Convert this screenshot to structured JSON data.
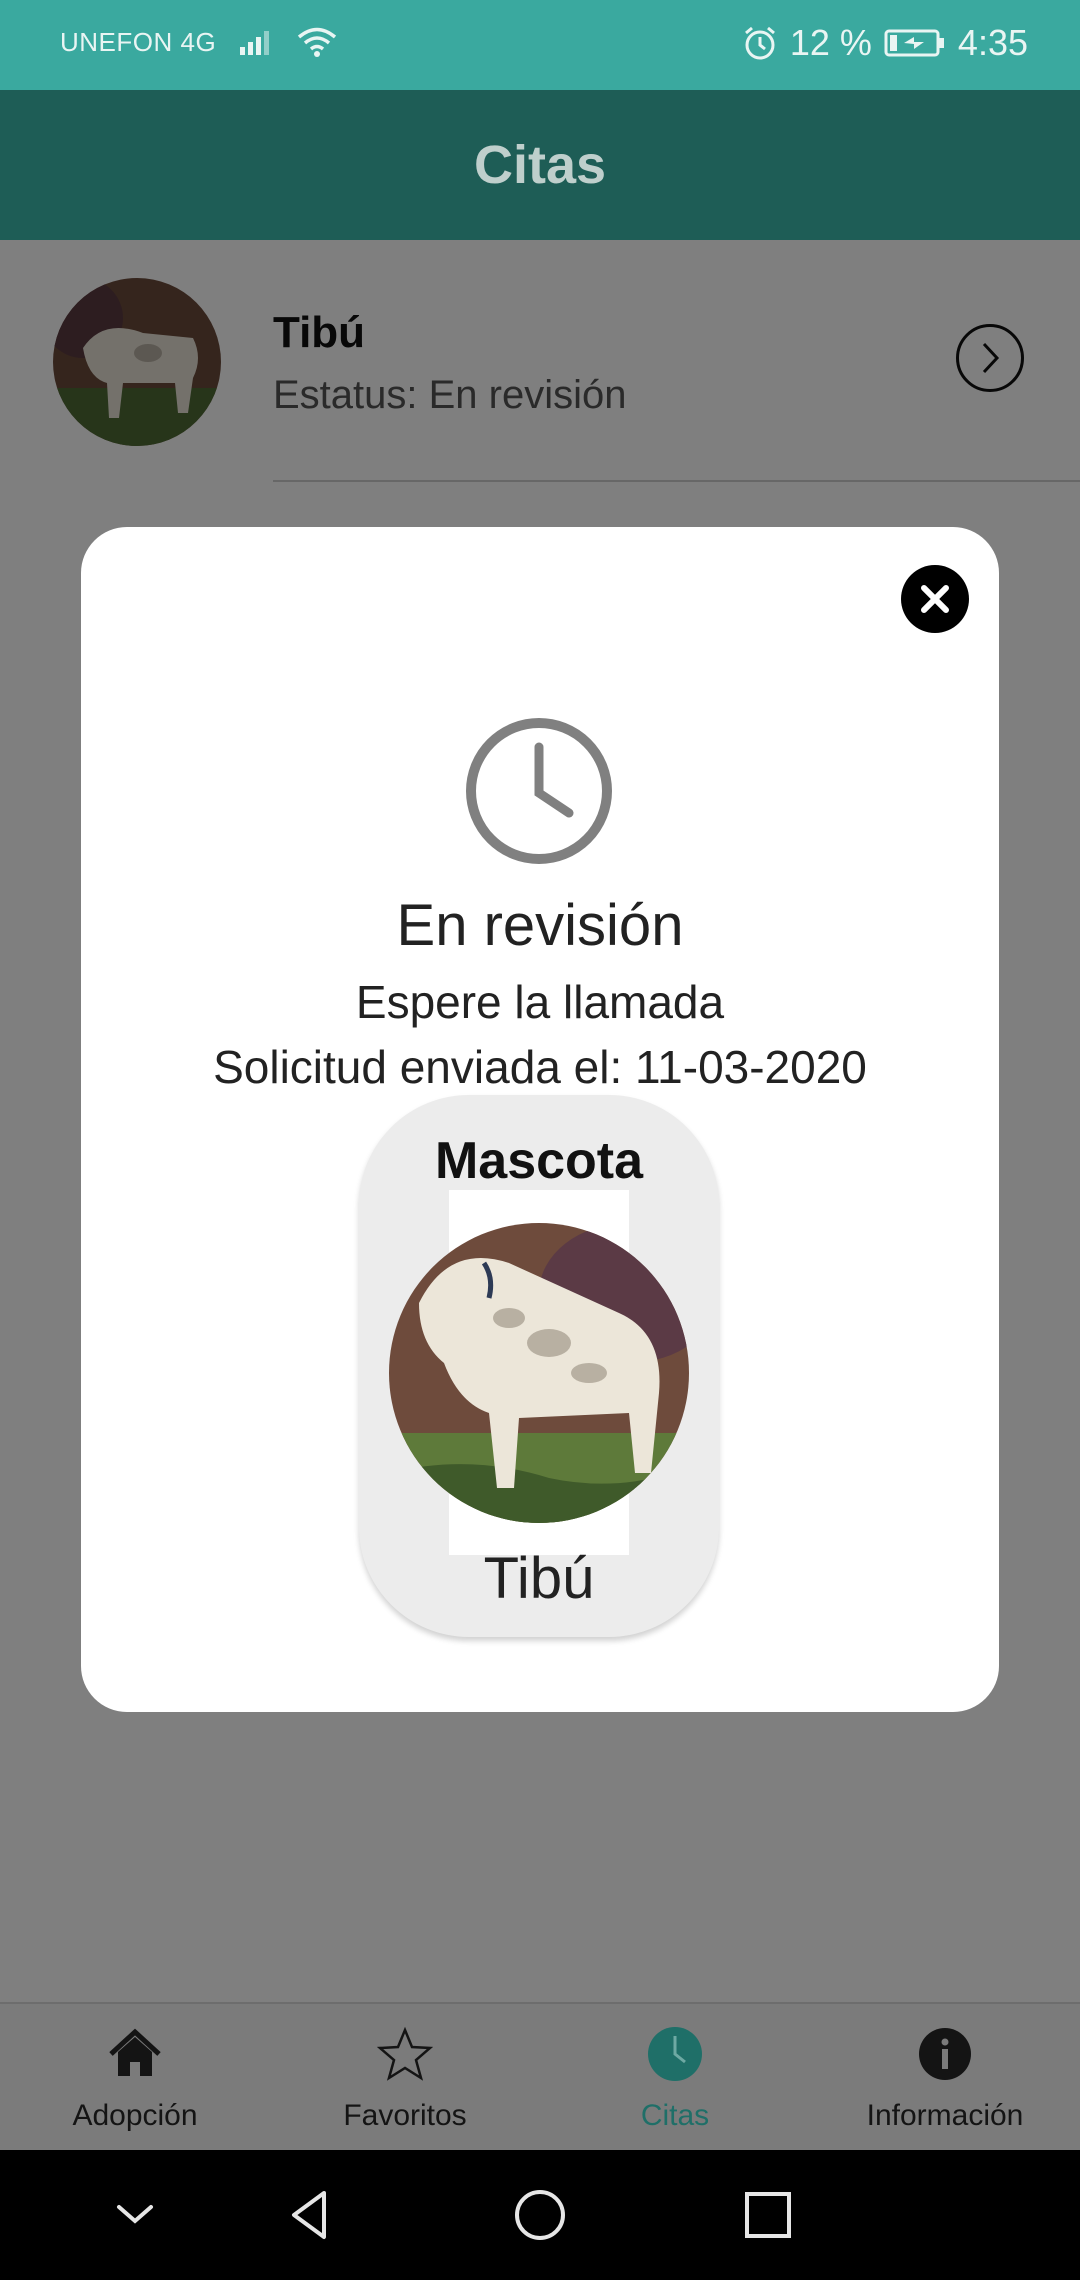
{
  "status_bar": {
    "carrier": "UNEFON 4G",
    "battery": "12 %",
    "time": "4:35",
    "icons": [
      "signal-icon",
      "wifi-icon",
      "alarm-icon",
      "battery-charging-icon"
    ]
  },
  "app_bar": {
    "title": "Citas"
  },
  "list": {
    "items": [
      {
        "name": "Tibú",
        "status": "Estatus: En revisión"
      }
    ]
  },
  "modal": {
    "title": "En revisión",
    "subtitle": "Espere la llamada",
    "date_text": "Solicitud enviada el: 11-03-2020",
    "pet_card": {
      "label": "Mascota",
      "name": "Tibú"
    }
  },
  "bottom_nav": {
    "items": [
      {
        "label": "Adopción",
        "icon": "home-icon"
      },
      {
        "label": "Favoritos",
        "icon": "star-icon"
      },
      {
        "label": "Citas",
        "icon": "clock-icon",
        "active": true
      },
      {
        "label": "Información",
        "icon": "info-icon"
      }
    ]
  },
  "colors": {
    "status_bar": "#3aa99f",
    "app_bar": "#1e5d56",
    "accent": "#1f6f68"
  }
}
